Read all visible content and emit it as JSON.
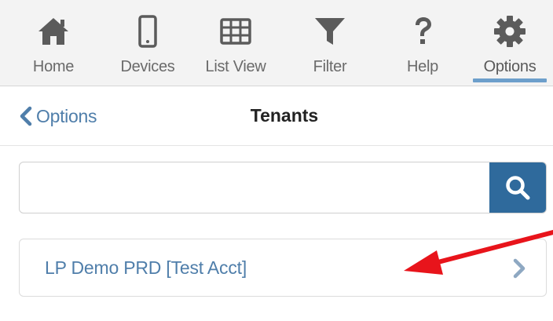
{
  "toolbar": {
    "items": [
      {
        "label": "Home",
        "icon": "home-icon"
      },
      {
        "label": "Devices",
        "icon": "device-icon"
      },
      {
        "label": "List View",
        "icon": "grid-icon"
      },
      {
        "label": "Filter",
        "icon": "filter-icon"
      },
      {
        "label": "Help",
        "icon": "help-icon"
      },
      {
        "label": "Options",
        "icon": "gear-icon",
        "active": true
      }
    ]
  },
  "header": {
    "back_label": "Options",
    "title": "Tenants"
  },
  "search": {
    "value": "",
    "placeholder": ""
  },
  "tenants": {
    "items": [
      {
        "label": "LP Demo PRD [Test Acct]"
      }
    ]
  },
  "colors": {
    "accent": "#2f6a9c",
    "link": "#4f7eaa",
    "icon": "#5b5b5b",
    "active_underline": "#6d9fcb",
    "annotation_arrow": "#e8141b"
  }
}
